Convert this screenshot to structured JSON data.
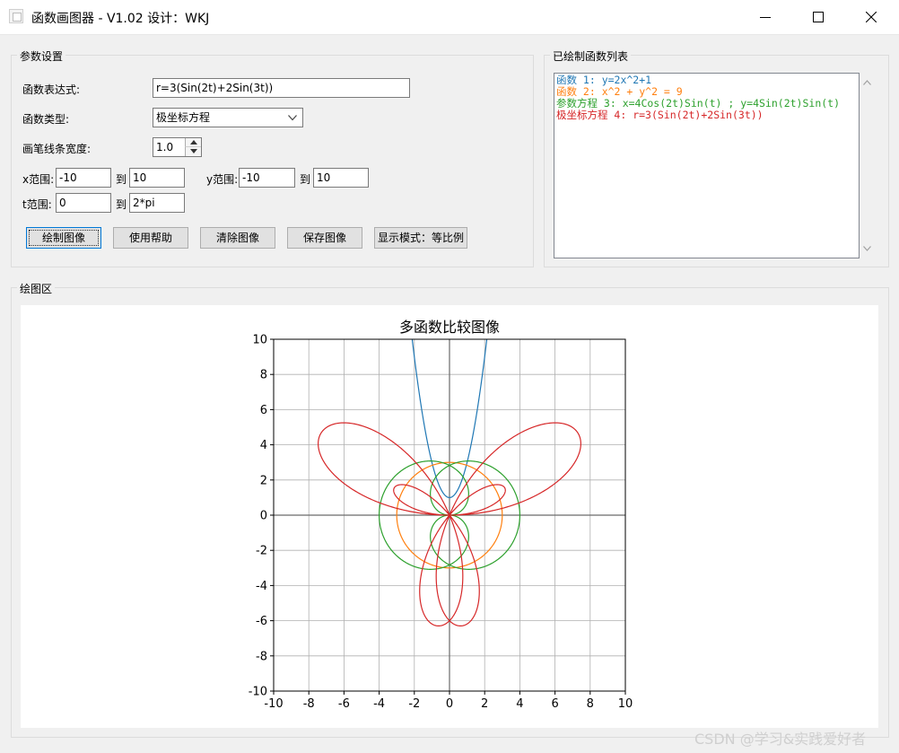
{
  "window": {
    "title": "函数画图器 - V1.02  设计：WKJ"
  },
  "params": {
    "group_title": "参数设置",
    "expr_label": "函数表达式:",
    "expr_value": "r=3(Sin(2t)+2Sin(3t))",
    "type_label": "函数类型:",
    "type_value": "极坐标方程",
    "width_label": "画笔线条宽度:",
    "width_value": "1.0",
    "x_range_label": "x范围:",
    "x_min": "-10",
    "x_max": "10",
    "y_range_label": "y范围:",
    "y_min": "-10",
    "y_max": "10",
    "t_range_label": "t范围:",
    "t_min": "0",
    "t_max": "2*pi",
    "to_label": "到"
  },
  "buttons": {
    "draw": "绘制图像",
    "help": "使用帮助",
    "clear": "清除图像",
    "save": "保存图像",
    "mode": "显示模式：等比例"
  },
  "list": {
    "group_title": "已绘制函数列表",
    "items": [
      {
        "text": "函数 1: y=2x^2+1",
        "color": "#1f77b4"
      },
      {
        "text": "函数 2: x^2 + y^2 = 9",
        "color": "#ff7f0e"
      },
      {
        "text": "参数方程 3: x=4Cos(2t)Sin(t) ; y=4Sin(2t)Sin(t)",
        "color": "#2ca02c"
      },
      {
        "text": "极坐标方程 4: r=3(Sin(2t)+2Sin(3t))",
        "color": "#d62728"
      }
    ]
  },
  "plot": {
    "group_title": "绘图区"
  },
  "chart_data": {
    "type": "line",
    "title": "多函数比较图像",
    "xlabel": "",
    "ylabel": "",
    "xlim": [
      -10,
      10
    ],
    "ylim": [
      -10,
      10
    ],
    "xticks": [
      -10,
      -8,
      -6,
      -4,
      -2,
      0,
      2,
      4,
      6,
      8,
      10
    ],
    "yticks": [
      -10,
      -8,
      -6,
      -4,
      -2,
      0,
      2,
      4,
      6,
      8,
      10
    ],
    "xtick_labels": [
      "-10",
      "-8",
      "-6",
      "-4",
      "-2",
      "0",
      "2",
      "4",
      "6",
      "8",
      "10"
    ],
    "ytick_labels": [
      "-10",
      "-8",
      "-6",
      "-4",
      "-2",
      "0",
      "2",
      "4",
      "6",
      "8",
      "10"
    ],
    "grid": true,
    "aspect": "equal",
    "series": [
      {
        "kind": "explicit",
        "expr": "y=2x^2+1",
        "color": "#1f77b4"
      },
      {
        "kind": "implicit-circle",
        "expr": "x^2 + y^2 = 9",
        "radius": 3,
        "color": "#ff7f0e"
      },
      {
        "kind": "parametric",
        "expr": "x=4Cos(2t)Sin(t) ; y=4Sin(2t)Sin(t)",
        "t_range": [
          0,
          6.2832
        ],
        "color": "#2ca02c"
      },
      {
        "kind": "polar",
        "expr": "r=3(Sin(2t)+2Sin(3t))",
        "t_range": [
          0,
          6.2832
        ],
        "color": "#d62728"
      }
    ]
  },
  "watermark": "CSDN @学习&实践爱好者"
}
